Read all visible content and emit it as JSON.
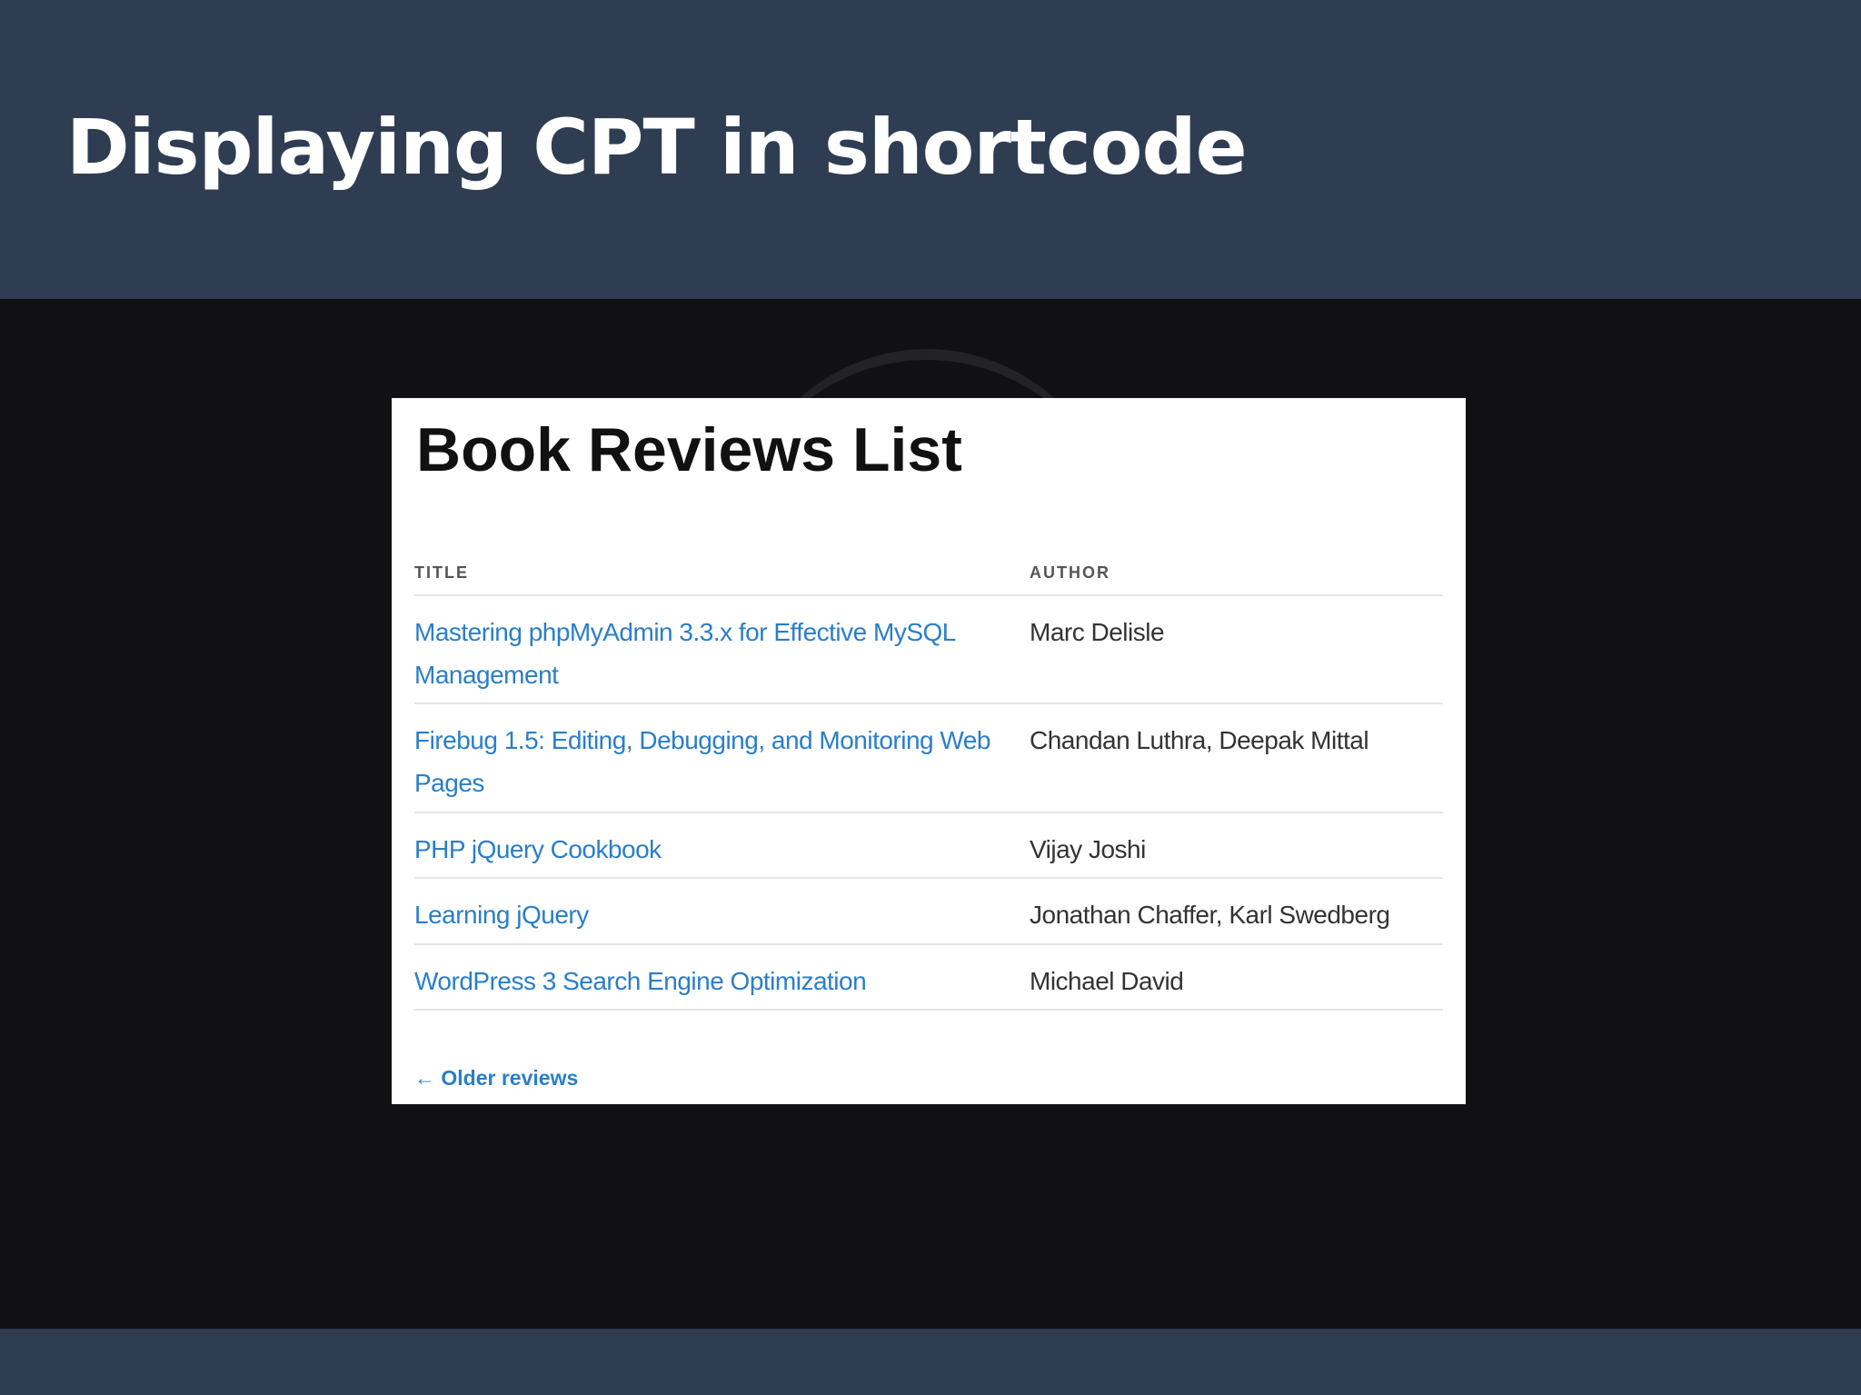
{
  "slide": {
    "title": "Displaying CPT in shortcode"
  },
  "panel": {
    "heading": "Book Reviews List",
    "columns": {
      "title": "TITLE",
      "author": "AUTHOR"
    },
    "rows": [
      {
        "title": "Mastering phpMyAdmin 3.3.x for Effective MySQL Management",
        "author": "Marc Delisle"
      },
      {
        "title": "Firebug 1.5: Editing, Debugging, and Monitoring Web Pages",
        "author": "Chandan Luthra, Deepak Mittal"
      },
      {
        "title": "PHP jQuery Cookbook",
        "author": "Vijay Joshi"
      },
      {
        "title": "Learning jQuery",
        "author": "Jonathan Chaffer, Karl Swedberg"
      },
      {
        "title": "WordPress 3 Search Engine Optimization",
        "author": "Michael David"
      }
    ],
    "older_link": "← Older reviews"
  },
  "colors": {
    "header_bg": "#2e3d52",
    "slide_bg": "#111113",
    "link": "#2a7ec8",
    "text": "#333333"
  }
}
